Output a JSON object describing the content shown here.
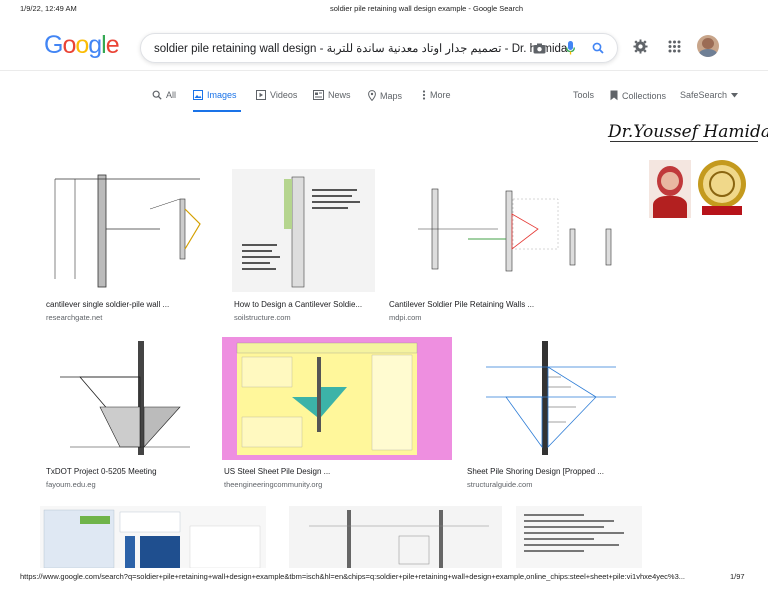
{
  "print_header": {
    "datetime": "1/9/22, 12:49 AM",
    "page_title": "soldier pile retaining wall design example - Google Search"
  },
  "search": {
    "query": "soldier pile retaining wall design - تصميم جدار اوتاد معدنية ساندة للتربة - Dr. hamida"
  },
  "nav": {
    "all": "All",
    "images": "Images",
    "videos": "Videos",
    "news": "News",
    "maps": "Maps",
    "more": "More",
    "tools": "Tools",
    "collections": "Collections",
    "safesearch": "SafeSearch"
  },
  "signature": "Dr.Youssef Hamida",
  "results": [
    {
      "title": "cantilever single soldier-pile wall ...",
      "source": "researchgate.net"
    },
    {
      "title": "How to Design a Cantilever Soldie...",
      "source": "soilstructure.com"
    },
    {
      "title": "Cantilever Soldier Pile Retaining Walls ...",
      "source": "mdpi.com"
    },
    {
      "title": "TxDOT Project 0-5205 Meeting",
      "source": "fayoum.edu.eg"
    },
    {
      "title": "US Steel Sheet Pile Design ...",
      "source": "theengineeringcommunity.org"
    },
    {
      "title": "Sheet Pile Shoring Design [Propped ...",
      "source": "structuralguide.com"
    }
  ],
  "print_footer": {
    "url": "https://www.google.com/search?q=soldier+pile+retaining+wall+design+example&tbm=isch&hl=en&chips=q:soldier+pile+retaining+wall+design+example,online_chips:steel+sheet+pile:vi1vhxe4yec%3...",
    "page": "1/97"
  },
  "colors": {
    "link_blue": "#1a73e8",
    "google_blue": "#4285f4",
    "google_red": "#ea4335",
    "google_yellow": "#fbbc05",
    "google_green": "#34a853"
  }
}
